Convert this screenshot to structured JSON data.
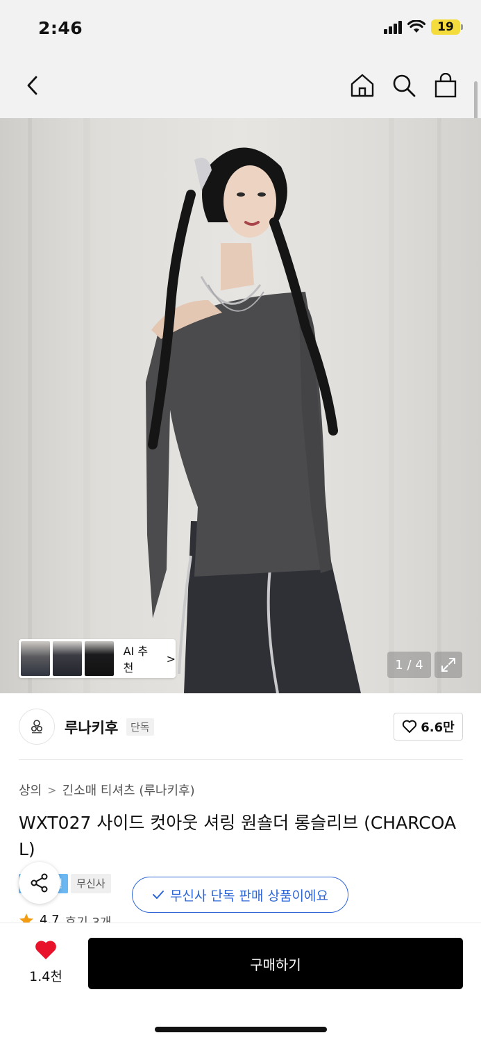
{
  "status_bar": {
    "time": "2:46",
    "battery": "19"
  },
  "nav": {
    "back_icon": "chevron-left-icon",
    "home_icon": "home-icon",
    "search_icon": "search-icon",
    "cart_icon": "shopping-bag-icon"
  },
  "gallery": {
    "ai_label": "AI 추천",
    "ai_chevron": ">",
    "page_indicator": "1 / 4",
    "expand_icon": "expand-icon"
  },
  "brand": {
    "name": "루나키후",
    "badge": "단독",
    "likes": "6.6만"
  },
  "breadcrumb": {
    "category": "상의",
    "separator": ">",
    "subcategory": "긴소매 티셔츠 (루나키후)"
  },
  "product": {
    "title": "WXT027 사이드 컷아웃 셔링 원숄더 롱슬리브 (CHARCOAL)",
    "tags": [
      "페스티벌",
      "무신사"
    ]
  },
  "toast": {
    "text": "무신사 단독 판매 상품이에요"
  },
  "rating": {
    "score": "4.7",
    "reviews": "후기 3개"
  },
  "bottom": {
    "like_count": "1.4천",
    "buy_label": "구매하기"
  },
  "colors": {
    "accent_blue": "#2c66d6",
    "tag_blue": "#6ab7f2",
    "heart_red": "#e8132a",
    "battery_yellow": "#f3dc3b",
    "star": "#f39c12"
  }
}
